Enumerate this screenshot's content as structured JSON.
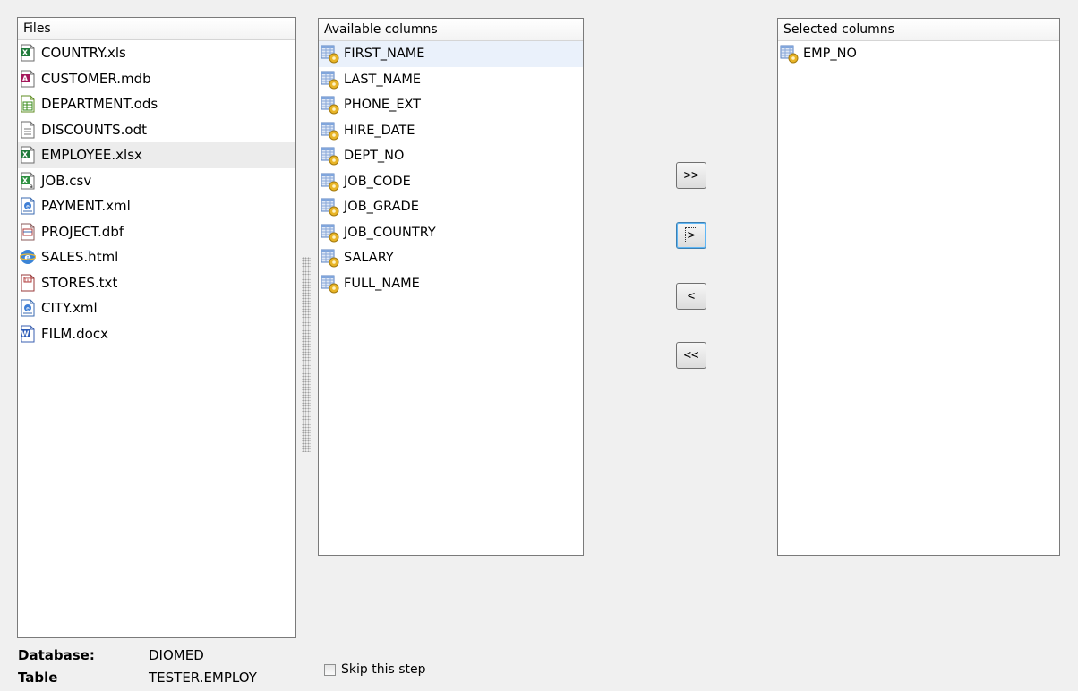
{
  "files_panel": {
    "header": "Files",
    "items": [
      {
        "name": "COUNTRY.xls",
        "icon": "excel-icon"
      },
      {
        "name": "CUSTOMER.mdb",
        "icon": "access-icon"
      },
      {
        "name": "DEPARTMENT.ods",
        "icon": "calc-spreadsheet-icon"
      },
      {
        "name": "DISCOUNTS.odt",
        "icon": "text-document-icon"
      },
      {
        "name": "EMPLOYEE.xlsx",
        "icon": "excel-icon",
        "selected": true
      },
      {
        "name": "JOB.csv",
        "icon": "csv-icon"
      },
      {
        "name": "PAYMENT.xml",
        "icon": "xml-icon"
      },
      {
        "name": "PROJECT.dbf",
        "icon": "dbf-icon"
      },
      {
        "name": "SALES.html",
        "icon": "html-icon"
      },
      {
        "name": "STORES.txt",
        "icon": "txt-icon"
      },
      {
        "name": "CITY.xml",
        "icon": "xml-icon"
      },
      {
        "name": "FILM.docx",
        "icon": "word-icon"
      }
    ]
  },
  "available_panel": {
    "header": "Available columns",
    "items": [
      "FIRST_NAME",
      "LAST_NAME",
      "PHONE_EXT",
      "HIRE_DATE",
      "DEPT_NO",
      "JOB_CODE",
      "JOB_GRADE",
      "JOB_COUNTRY",
      "SALARY",
      "FULL_NAME"
    ]
  },
  "selected_panel": {
    "header": "Selected columns",
    "items": [
      "EMP_NO"
    ]
  },
  "buttons": {
    "add_all": ">>",
    "add": ">",
    "remove": "<",
    "remove_all": "<<"
  },
  "info": {
    "database_label": "Database:",
    "database_value": "DIOMED",
    "table_label": "Table",
    "table_value": "TESTER.EMPLOY"
  },
  "skip": {
    "label": "Skip this step",
    "checked": false
  },
  "colors": {
    "selected_row": "#ececec",
    "focus_row": "#eaf1fb",
    "panel_border": "#7a7a7a"
  }
}
